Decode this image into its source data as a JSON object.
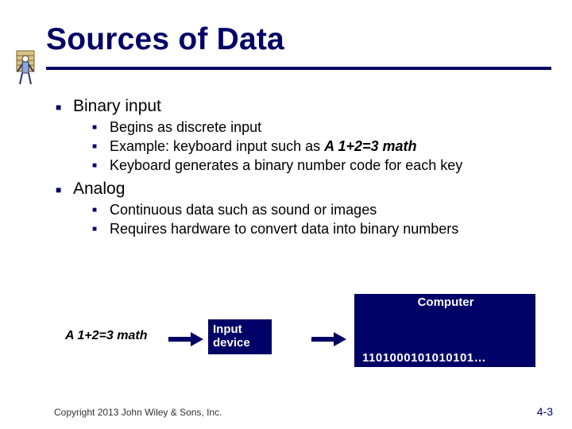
{
  "title": "Sources of Data",
  "bullets": {
    "item1": {
      "label": "Binary input",
      "sub": [
        {
          "text": "Begins as discrete input"
        },
        {
          "prefix": "Example: keyboard input such as ",
          "emph": "A  1+2=3 math"
        },
        {
          "text": "Keyboard generates a binary number code for each key"
        }
      ]
    },
    "item2": {
      "label": "Analog",
      "sub": [
        {
          "text": "Continuous data such as sound or images"
        },
        {
          "text": "Requires hardware to convert data into binary numbers"
        }
      ]
    }
  },
  "diagram": {
    "source_text": "A 1+2=3 math",
    "input_device_l1": "Input",
    "input_device_l2": "device",
    "computer_label": "Computer",
    "binary_stream": "1101000101010101…"
  },
  "footer": {
    "copyright": "Copyright 2013 John Wiley & Sons, Inc.",
    "page": "4-3"
  }
}
